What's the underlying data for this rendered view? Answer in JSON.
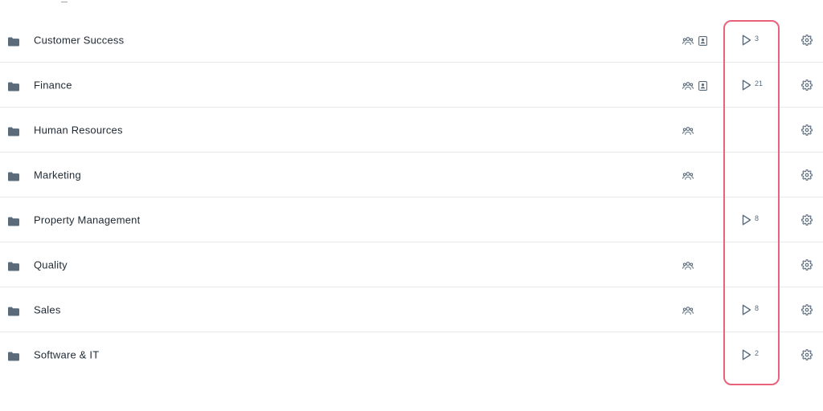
{
  "icons": {
    "folder": "folder-icon",
    "team": "team-icon",
    "contact": "contact-card-icon",
    "play": "play-icon",
    "gear": "gear-icon"
  },
  "colors": {
    "icon": "#5b6b7a",
    "text": "#1f2933",
    "divider": "#e6e8eb",
    "highlight": "#e8627a"
  },
  "rows": [
    {
      "name": "Customer Success",
      "team": true,
      "contact": true,
      "count": "3"
    },
    {
      "name": "Finance",
      "team": true,
      "contact": true,
      "count": "21"
    },
    {
      "name": "Human Resources",
      "team": true,
      "contact": false,
      "count": null
    },
    {
      "name": "Marketing",
      "team": true,
      "contact": false,
      "count": null
    },
    {
      "name": "Property Management",
      "team": false,
      "contact": false,
      "count": "8"
    },
    {
      "name": "Quality",
      "team": true,
      "contact": false,
      "count": null
    },
    {
      "name": "Sales",
      "team": true,
      "contact": false,
      "count": "8"
    },
    {
      "name": "Software & IT",
      "team": false,
      "contact": false,
      "count": "2"
    }
  ]
}
